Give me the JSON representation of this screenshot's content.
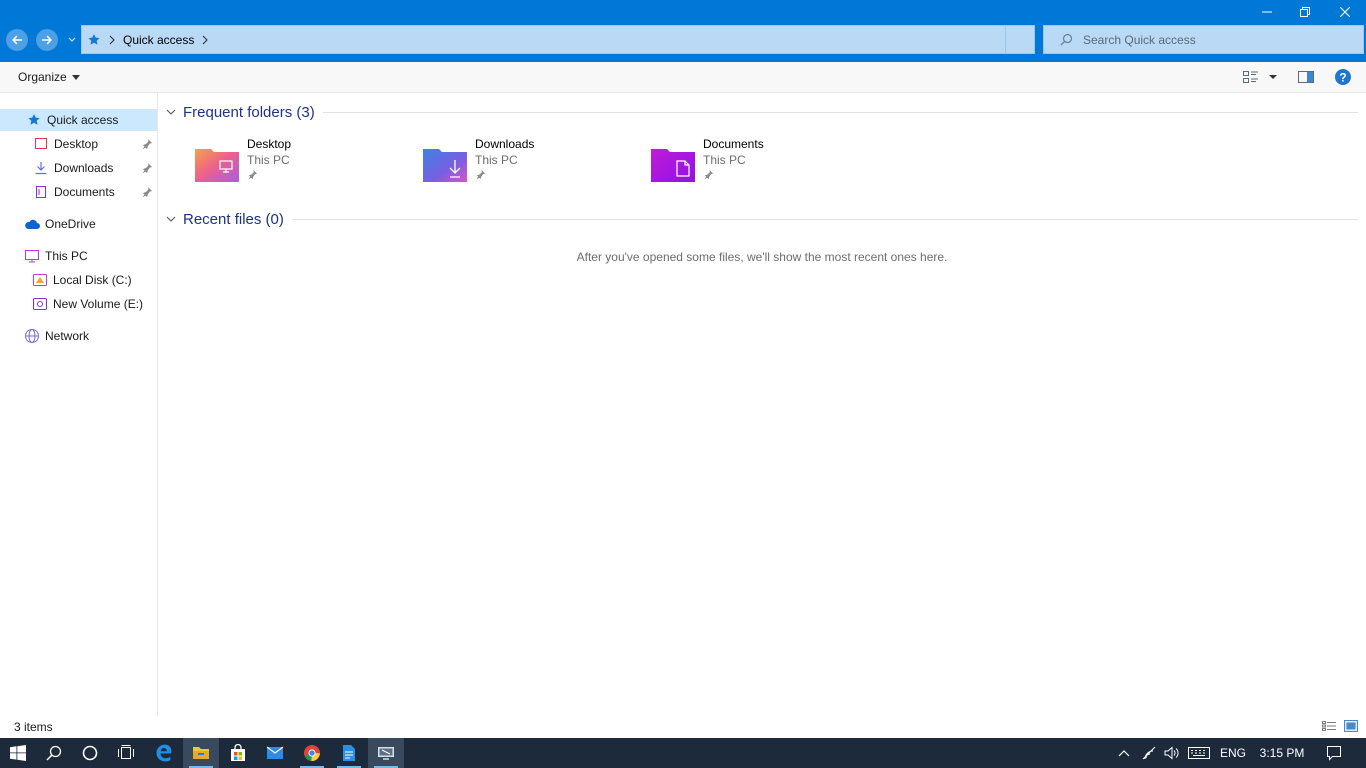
{
  "window": {
    "address_location": "Quick access",
    "search_placeholder": "Search Quick access"
  },
  "toolbar": {
    "organize_label": "Organize"
  },
  "sidebar": {
    "items": [
      {
        "label": "Quick access",
        "icon": "star-icon",
        "selected": true,
        "pinned": false
      },
      {
        "label": "Desktop",
        "icon": "desktop-icon",
        "pinned": true
      },
      {
        "label": "Downloads",
        "icon": "download-icon",
        "pinned": true
      },
      {
        "label": "Documents",
        "icon": "documents-icon",
        "pinned": true
      },
      {
        "label": "OneDrive",
        "icon": "cloud-icon",
        "pinned": false
      },
      {
        "label": "This PC",
        "icon": "computer-icon",
        "pinned": false
      },
      {
        "label": "Local Disk (C:)",
        "icon": "drive-icon",
        "pinned": false
      },
      {
        "label": "New Volume (E:)",
        "icon": "drive-icon",
        "pinned": false
      },
      {
        "label": "Network",
        "icon": "network-icon",
        "pinned": false
      }
    ]
  },
  "main": {
    "frequent_folders": {
      "title": "Frequent folders (3)",
      "items": [
        {
          "name": "Desktop",
          "location": "This PC",
          "icon": "desktop-folder-icon"
        },
        {
          "name": "Downloads",
          "location": "This PC",
          "icon": "downloads-folder-icon"
        },
        {
          "name": "Documents",
          "location": "This PC",
          "icon": "documents-folder-icon"
        }
      ]
    },
    "recent_files": {
      "title": "Recent files (0)",
      "empty_message": "After you've opened some files, we'll show the most recent ones here."
    }
  },
  "status": {
    "item_count": "3 items"
  },
  "taskbar": {
    "language": "ENG",
    "time": "3:15 PM"
  },
  "colors": {
    "accent": "#0078d7",
    "taskbar": "#1c2a3b",
    "selection": "#cce8ff",
    "group_title": "#1e3287"
  }
}
